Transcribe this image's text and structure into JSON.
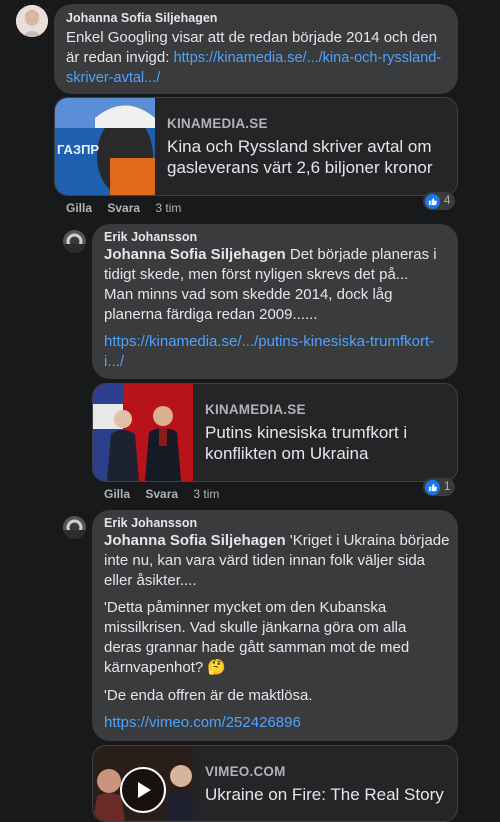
{
  "comments": [
    {
      "author": "Johanna Sofia Siljehagen",
      "text": "Enkel Googling visar att de redan började 2014 och den är redan invigd: ",
      "link": "https://kinamedia.se/.../kina-och-ryssland-skriver-avtal.../",
      "card": {
        "domain": "KINAMEDIA.SE",
        "title": "Kina och Ryssland skriver avtal om gasleverans värt 2,6 biljoner kronor"
      },
      "actions": {
        "like": "Gilla",
        "reply": "Svara",
        "time": "3 tim"
      },
      "reaction_count": "4"
    },
    {
      "author": "Erik Johansson",
      "mention": "Johanna Sofia Siljehagen",
      "text": " Det började planeras i tidigt skede, men först nyligen skrevs det på...\nMan minns vad som skedde 2014, dock låg planerna färdiga redan 2009......",
      "link": "https://kinamedia.se/.../putins-kinesiska-trumfkort-i.../",
      "card": {
        "domain": "KINAMEDIA.SE",
        "title": "Putins kinesiska trumfkort i konflikten om Ukraina"
      },
      "actions": {
        "like": "Gilla",
        "reply": "Svara",
        "time": "3 tim"
      },
      "reaction_count": "1"
    },
    {
      "author": "Erik Johansson",
      "mention": "Johanna Sofia Siljehagen",
      "text": " 'Kriget i Ukraina började inte nu, kan vara värd tiden innan folk väljer sida eller åsikter....",
      "para2": "'Detta påminner mycket om den Kubanska missilkrisen. Vad skulle jänkarna göra om alla deras grannar hade gått samman mot de med kärnvapenhot? ",
      "emoji": "🤔",
      "para3": "'De enda offren är de maktlösa.",
      "link": "https://vimeo.com/252426896",
      "card": {
        "domain": "VIMEO.COM",
        "title": "Ukraine on Fire: The Real Story"
      }
    }
  ],
  "icons": {
    "like": "thumbs-up-icon",
    "play": "play-icon"
  }
}
